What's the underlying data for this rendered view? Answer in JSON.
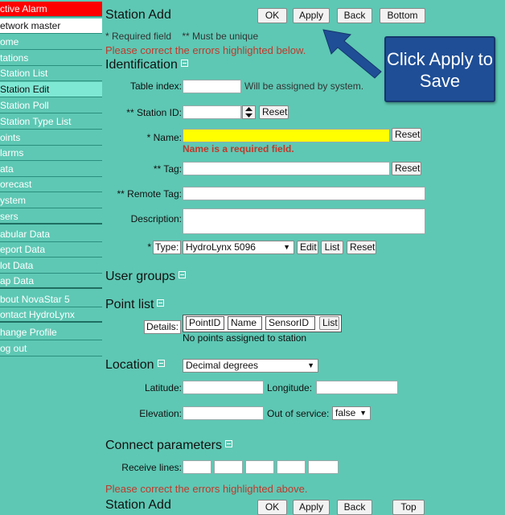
{
  "sidebar": {
    "items": [
      {
        "label": "ctive Alarm"
      },
      {
        "label": "etwork master"
      },
      {
        "label": "ome"
      },
      {
        "label": "tations"
      },
      {
        "label": " Station List"
      },
      {
        "label": " Station Edit"
      },
      {
        "label": "Station Poll"
      },
      {
        "label": "Station Type List"
      },
      {
        "label": "oints"
      },
      {
        "label": "larms"
      },
      {
        "label": "ata"
      },
      {
        "label": "orecast"
      },
      {
        "label": "ystem"
      },
      {
        "label": "sers"
      },
      {
        "label": "abular Data"
      },
      {
        "label": "eport Data"
      },
      {
        "label": "lot Data"
      },
      {
        "label": "ap Data"
      },
      {
        "label": "bout NovaStar 5"
      },
      {
        "label": "ontact HydroLynx"
      },
      {
        "label": "hange Profile"
      },
      {
        "label": "og out"
      }
    ]
  },
  "header": {
    "title": "Station Add",
    "ok": "OK",
    "apply": "Apply",
    "back": "Back",
    "bottom": "Bottom",
    "required_note": "* Required field    ** Must be unique",
    "error_top": "Please correct the errors highlighted below.",
    "callout": "Click Apply to Save"
  },
  "identification": {
    "heading": "Identification",
    "table_index_label": "Table index:",
    "table_index_note": "Will be assigned by system.",
    "station_id_label": "** Station ID:",
    "reset": "Reset",
    "name_label": "* Name:",
    "name_error": "Name is a required field.",
    "tag_label": "** Tag:",
    "remote_tag_label": "** Remote Tag:",
    "description_label": "Description:",
    "type_star": "*",
    "type_label": "Type:",
    "type_value": "HydroLynx 5096",
    "edit": "Edit",
    "list": "List"
  },
  "user_groups": {
    "heading": "User groups"
  },
  "point_list": {
    "heading": "Point list",
    "details": "Details:",
    "cols": [
      "PointID",
      "Name",
      "SensorID"
    ],
    "list": "List",
    "empty": "No points assigned to station"
  },
  "location": {
    "heading": "Location",
    "format": "Decimal degrees",
    "latitude": "Latitude:",
    "longitude": "Longitude:",
    "elevation": "Elevation:",
    "out_of_service": "Out of service:",
    "oos_value": "false"
  },
  "connect": {
    "heading": "Connect parameters",
    "receive_lines": "Receive lines:"
  },
  "footer": {
    "error_bottom": "Please correct the errors highlighted above.",
    "title_clipped": "Station Add",
    "ok": "OK",
    "apply": "Apply",
    "back": "Back",
    "top": "Top"
  },
  "colors": {
    "background": "#5ec8b4",
    "alarm": "#ff0000",
    "name_highlight": "#ffff00",
    "error": "#c0392b",
    "callout": "#1f4e96"
  }
}
